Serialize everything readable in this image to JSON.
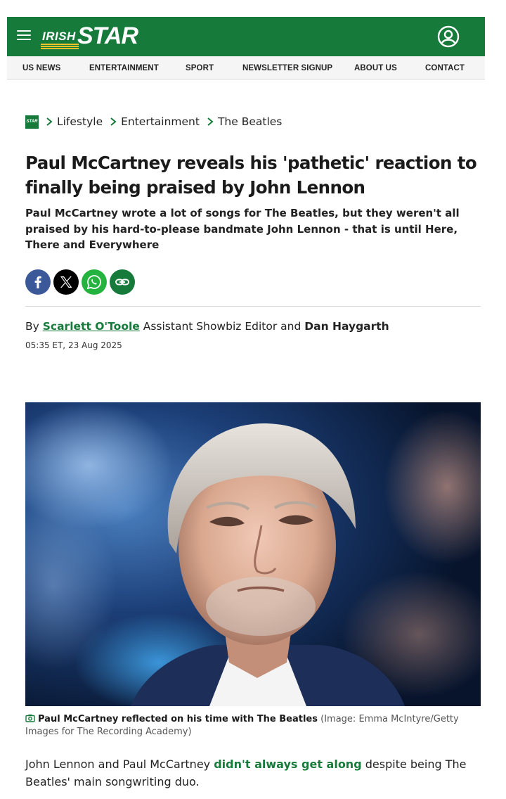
{
  "brand": {
    "name_top": "IRISH",
    "name_main": "STAR",
    "badge": "STAR",
    "accent": "#167a3a",
    "stripe": "#f3c22b"
  },
  "header": {
    "menu_icon": "hamburger-menu-icon",
    "account_icon": "user-account-icon"
  },
  "nav": {
    "items": [
      {
        "label": "US NEWS"
      },
      {
        "label": "ENTERTAINMENT"
      },
      {
        "label": "SPORT"
      },
      {
        "label": "NEWSLETTER SIGNUP"
      },
      {
        "label": "ABOUT US"
      },
      {
        "label": "CONTACT"
      }
    ]
  },
  "breadcrumb": {
    "items": [
      "Lifestyle",
      "Entertainment",
      "The Beatles"
    ]
  },
  "article": {
    "headline": "Paul McCartney reveals his 'pathetic' reaction to finally being praised by John Lennon",
    "standfirst": "Paul McCartney wrote a lot of songs for The Beatles, but they weren't all praised by his hard-to-please bandmate John Lennon - that is until Here, There and Everywhere",
    "share_icons": [
      "facebook-icon",
      "x-icon",
      "whatsapp-icon",
      "link-icon"
    ],
    "byline": {
      "by": "By",
      "author1": "Scarlett O'Toole",
      "role1": "Assistant Showbiz Editor",
      "and": "and",
      "author2": "Dan Haygarth"
    },
    "timestamp": "05:35 ET, 23 Aug 2025",
    "image": {
      "caption": "Paul McCartney reflected on his time with The Beatles",
      "credit": "(Image: Emma McIntyre/Getty Images for The Recording Academy)"
    },
    "body": {
      "p1_before": "John Lennon and Paul McCartney",
      "p1_link": "didn't always get along",
      "p1_after": "despite being The Beatles' main songwriting duo."
    }
  }
}
